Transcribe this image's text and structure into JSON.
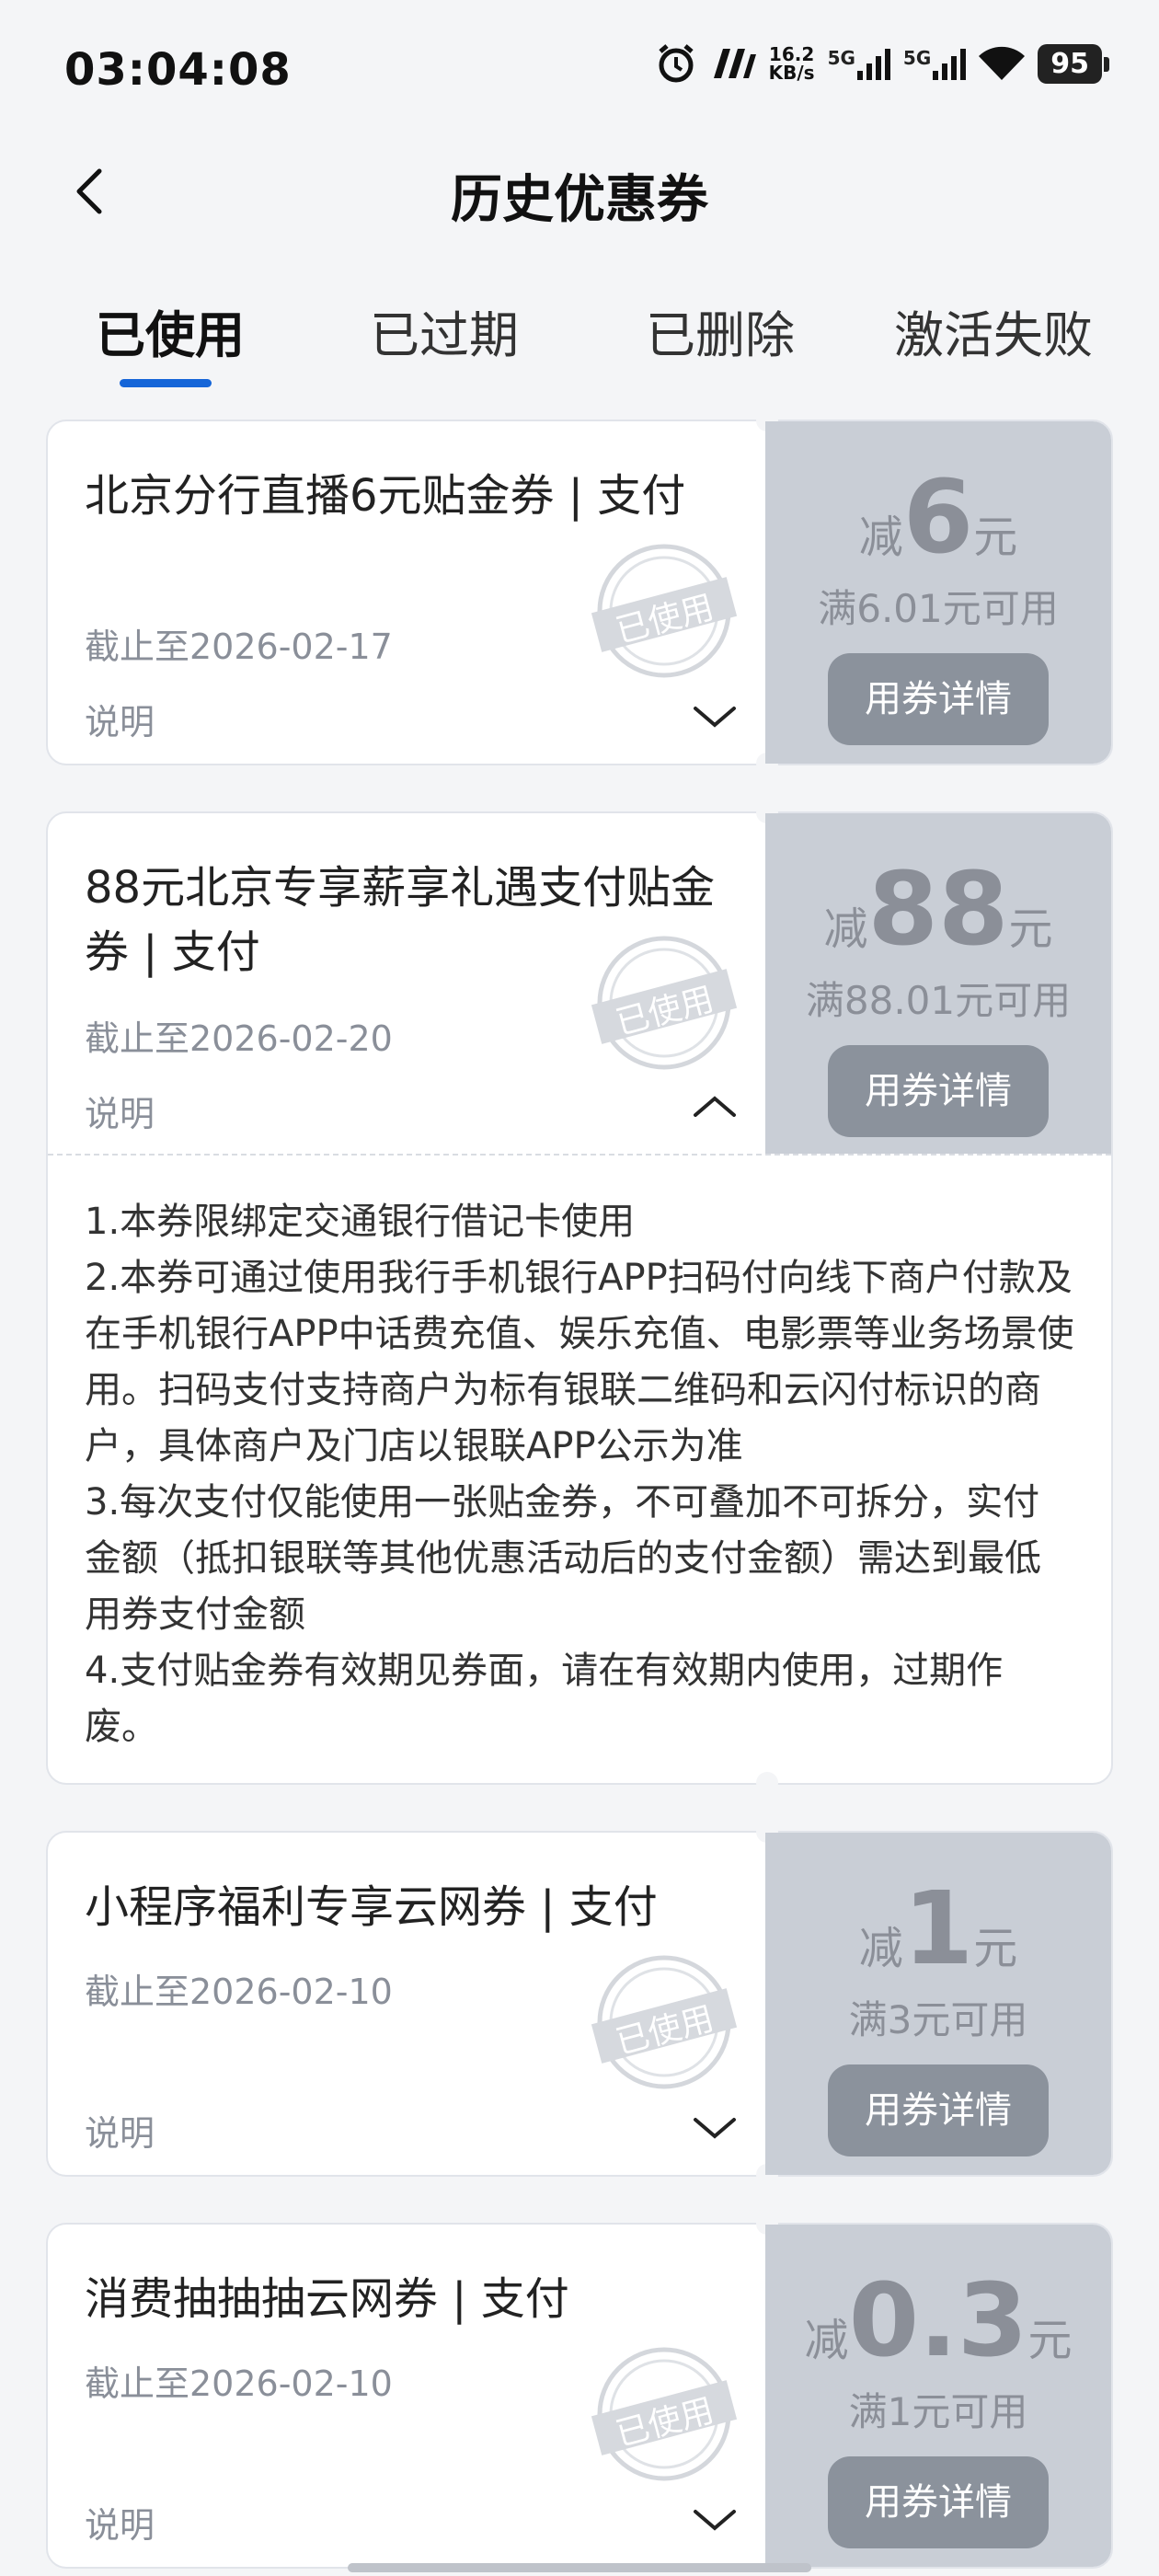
{
  "status": {
    "time": "03:04:08",
    "net_speed_value": "16.2",
    "net_speed_unit": "KB/s",
    "signal1": "5G",
    "signal2": "5G",
    "battery": "95"
  },
  "nav": {
    "title": "历史优惠券"
  },
  "tabs": [
    {
      "label": "已使用"
    },
    {
      "label": "已过期"
    },
    {
      "label": "已删除"
    },
    {
      "label": "激活失败"
    }
  ],
  "labels": {
    "note": "说明",
    "detail_button": "用券详情",
    "stamp": "已使用",
    "amount_prefix": "减",
    "amount_unit": "元"
  },
  "coupons": [
    {
      "title": "北京分行直播6元贴金券 | 支付",
      "deadline": "截止至2026-02-17",
      "amount": "6",
      "condition": "满6.01元可用",
      "expanded": false
    },
    {
      "title": "88元北京专享薪享礼遇支付贴金券 | 支付",
      "deadline": "截止至2026-02-20",
      "amount": "88",
      "condition": "满88.01元可用",
      "expanded": true,
      "description": [
        "1.本券限绑定交通银行借记卡使用",
        "2.本券可通过使用我行手机银行APP扫码付向线下商户付款及在手机银行APP中话费充值、娱乐充值、电影票等业务场景使用。扫码支付支持商户为标有银联二维码和云闪付标识的商户，具体商户及门店以银联APP公示为准",
        "3.每次支付仅能使用一张贴金券，不可叠加不可拆分，实付金额（抵扣银联等其他优惠活动后的支付金额）需达到最低用券支付金额",
        "4.支付贴金券有效期见券面，请在有效期内使用，过期作废。"
      ]
    },
    {
      "title": "小程序福利专享云网券 | 支付",
      "deadline": "截止至2026-02-10",
      "amount": "1",
      "condition": "满3元可用",
      "expanded": false
    },
    {
      "title": "消费抽抽抽云网券 | 支付",
      "deadline": "截止至2026-02-10",
      "amount": "0.3",
      "condition": "满1元可用",
      "expanded": false
    }
  ],
  "colors": {
    "accent": "#1565d8",
    "coupon_panel": "#c9ced6",
    "button": "#8b929c"
  }
}
